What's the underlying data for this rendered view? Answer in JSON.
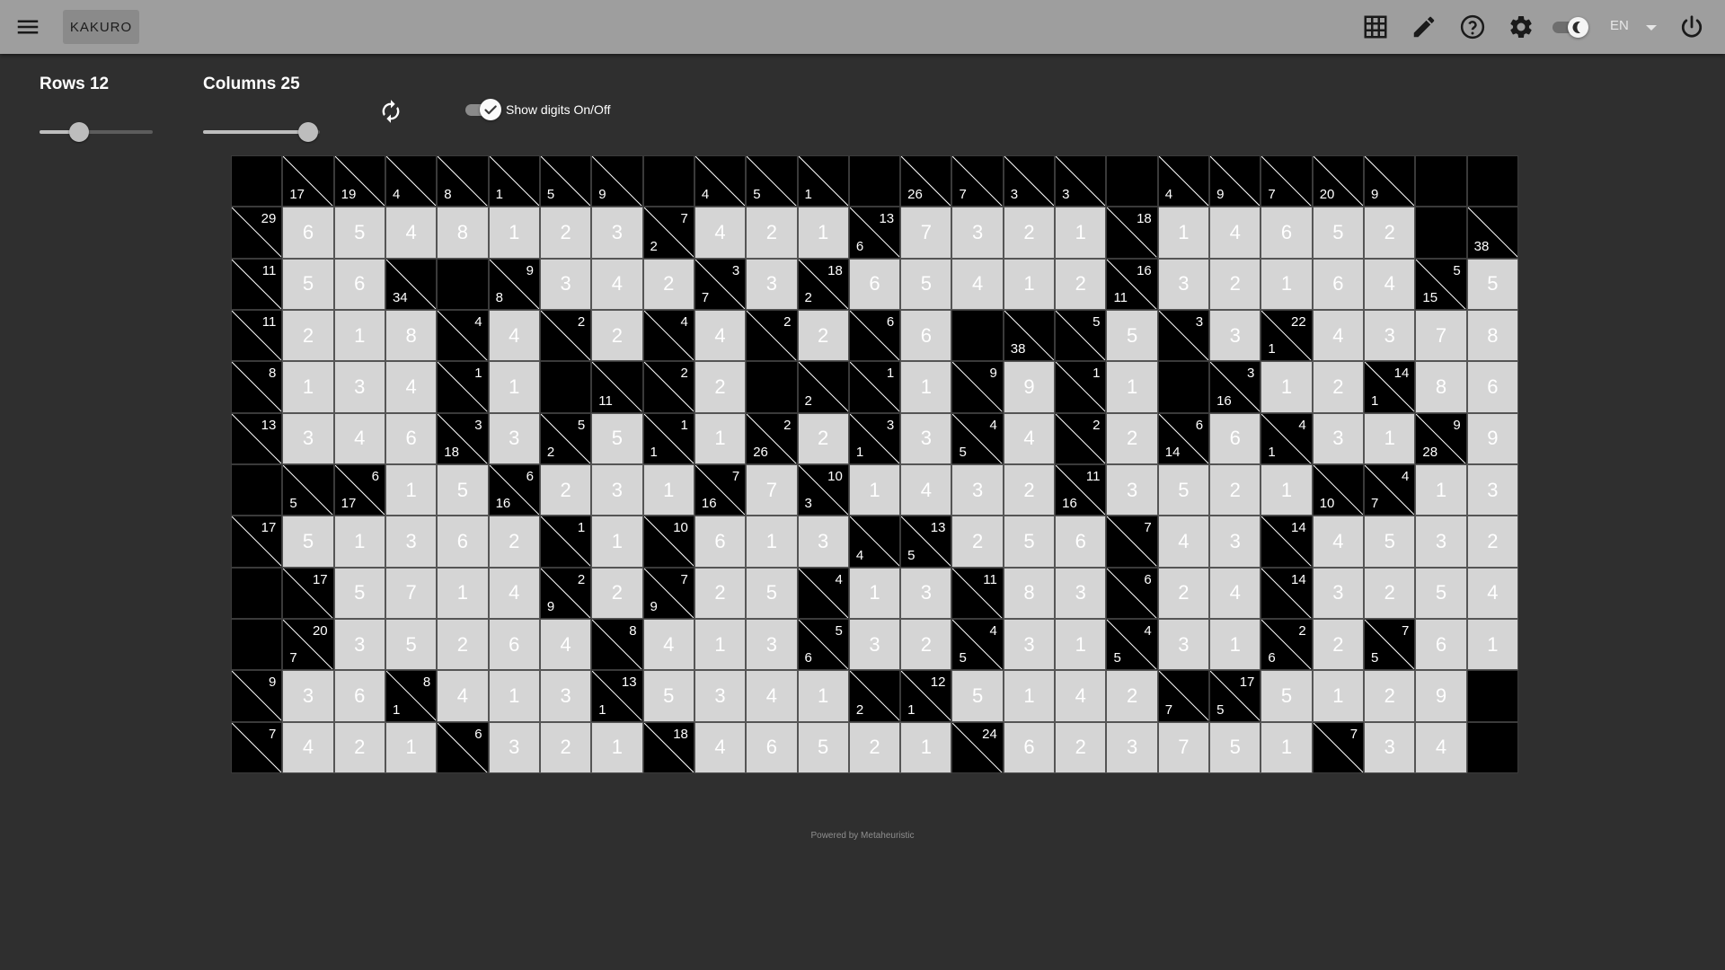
{
  "header": {
    "title": "KAKURO",
    "language": "EN",
    "icons": [
      "menu-icon",
      "grid-icon",
      "pencil-icon",
      "help-icon",
      "settings-icon",
      "dark-mode-icon",
      "power-icon"
    ]
  },
  "controls": {
    "rows_label": "Rows 12",
    "rows_value": 12,
    "rows_fraction": 0.35,
    "columns_label": "Columns 25",
    "columns_value": 25,
    "columns_fraction": 0.9,
    "show_digits_label": "Show digits On/Off",
    "show_digits_on": true,
    "dark_mode_on": true
  },
  "board": {
    "rows": 12,
    "columns": 25,
    "colors": {
      "black": "#000000",
      "white": "#d5d5d5",
      "digit": "#ffffff"
    },
    "cells": [
      [
        [
          "x"
        ],
        [
          "c",
          17
        ],
        [
          "c",
          19
        ],
        [
          "c",
          4
        ],
        [
          "c",
          8
        ],
        [
          "c",
          1
        ],
        [
          "c",
          5
        ],
        [
          "c",
          9
        ],
        [
          "x"
        ],
        [
          "c",
          4
        ],
        [
          "c",
          5
        ],
        [
          "c",
          1
        ],
        [
          "x"
        ],
        [
          "c",
          26
        ],
        [
          "c",
          7
        ],
        [
          "c",
          3
        ],
        [
          "c",
          3
        ],
        [
          "x"
        ],
        [
          "c",
          4
        ],
        [
          "c",
          9
        ],
        [
          "c",
          7
        ],
        [
          "c",
          20
        ],
        [
          "c",
          9
        ],
        [
          "x"
        ],
        [
          "x"
        ]
      ],
      [
        [
          "c",
          null,
          29
        ],
        6,
        5,
        4,
        8,
        1,
        2,
        3,
        [
          "c",
          2,
          7
        ],
        4,
        2,
        1,
        [
          "c",
          6,
          13
        ],
        7,
        3,
        2,
        1,
        [
          "c",
          null,
          18
        ],
        1,
        4,
        6,
        5,
        2,
        [
          "x"
        ],
        [
          "c",
          38
        ]
      ],
      [
        [
          "c",
          null,
          11
        ],
        5,
        6,
        [
          "c",
          34
        ],
        [
          "x"
        ],
        [
          "c",
          8,
          9
        ],
        3,
        4,
        2,
        [
          "c",
          7,
          3
        ],
        3,
        [
          "c",
          2,
          18
        ],
        6,
        5,
        4,
        1,
        2,
        [
          "c",
          11,
          16
        ],
        3,
        2,
        1,
        6,
        4,
        [
          "c",
          15,
          5
        ],
        5
      ],
      [
        [
          "c",
          null,
          11
        ],
        2,
        1,
        8,
        [
          "c",
          null,
          4
        ],
        4,
        [
          "c",
          null,
          2
        ],
        2,
        [
          "c",
          null,
          4
        ],
        4,
        [
          "c",
          null,
          2
        ],
        2,
        [
          "c",
          null,
          6
        ],
        6,
        [
          "x"
        ],
        [
          "c",
          38
        ],
        [
          "c",
          null,
          5
        ],
        5,
        [
          "c",
          null,
          3
        ],
        3,
        [
          "c",
          1,
          22
        ],
        4,
        3,
        7,
        8
      ],
      [
        [
          "c",
          null,
          8
        ],
        1,
        3,
        4,
        [
          "c",
          null,
          1
        ],
        1,
        [
          "x"
        ],
        [
          "c",
          11
        ],
        [
          "c",
          null,
          2
        ],
        2,
        [
          "x"
        ],
        [
          "c",
          2
        ],
        [
          "c",
          null,
          1
        ],
        1,
        [
          "c",
          null,
          9
        ],
        9,
        [
          "c",
          null,
          1
        ],
        1,
        [
          "x"
        ],
        [
          "c",
          16,
          3
        ],
        1,
        2,
        [
          "c",
          1,
          14
        ],
        8,
        6
      ],
      [
        [
          "c",
          null,
          13
        ],
        3,
        4,
        6,
        [
          "c",
          18,
          3
        ],
        3,
        [
          "c",
          2,
          5
        ],
        5,
        [
          "c",
          1,
          1
        ],
        1,
        [
          "c",
          26,
          2
        ],
        2,
        [
          "c",
          1,
          3
        ],
        3,
        [
          "c",
          5,
          4
        ],
        4,
        [
          "c",
          null,
          2
        ],
        2,
        [
          "c",
          14,
          6
        ],
        6,
        [
          "c",
          1,
          4
        ],
        3,
        1,
        [
          "c",
          28,
          9
        ],
        9
      ],
      [
        [
          "x"
        ],
        [
          "c",
          5
        ],
        [
          "c",
          17,
          6
        ],
        1,
        5,
        [
          "c",
          16,
          6
        ],
        2,
        3,
        1,
        [
          "c",
          16,
          7
        ],
        7,
        [
          "c",
          3,
          10
        ],
        1,
        4,
        3,
        2,
        [
          "c",
          16,
          11
        ],
        3,
        5,
        2,
        1,
        [
          "c",
          10
        ],
        [
          "c",
          7,
          4
        ],
        1,
        3
      ],
      [
        [
          "c",
          null,
          17
        ],
        5,
        1,
        3,
        6,
        2,
        [
          "c",
          null,
          1
        ],
        1,
        [
          "c",
          null,
          10
        ],
        6,
        1,
        3,
        [
          "c",
          4
        ],
        [
          "c",
          5,
          13
        ],
        2,
        5,
        6,
        [
          "c",
          null,
          7
        ],
        4,
        3,
        [
          "c",
          null,
          14
        ],
        4,
        5,
        3,
        2
      ],
      [
        [
          "x"
        ],
        [
          "c",
          null,
          17
        ],
        5,
        7,
        1,
        4,
        [
          "c",
          9,
          2
        ],
        2,
        [
          "c",
          9,
          7
        ],
        2,
        5,
        [
          "c",
          null,
          4
        ],
        1,
        3,
        [
          "c",
          null,
          11
        ],
        8,
        3,
        [
          "c",
          null,
          6
        ],
        2,
        4,
        [
          "c",
          null,
          14
        ],
        3,
        2,
        5,
        4
      ],
      [
        [
          "x"
        ],
        [
          "c",
          7,
          20
        ],
        3,
        5,
        2,
        6,
        4,
        [
          "c",
          null,
          8
        ],
        4,
        1,
        3,
        [
          "c",
          6,
          5
        ],
        3,
        2,
        [
          "c",
          5,
          4
        ],
        3,
        1,
        [
          "c",
          5,
          4
        ],
        3,
        1,
        [
          "c",
          6,
          2
        ],
        2,
        [
          "c",
          5,
          7
        ],
        6,
        1
      ],
      [
        [
          "c",
          null,
          9
        ],
        3,
        6,
        [
          "c",
          1,
          8
        ],
        4,
        1,
        3,
        [
          "c",
          1,
          13
        ],
        5,
        3,
        4,
        1,
        [
          "c",
          2
        ],
        [
          "c",
          1,
          12
        ],
        5,
        1,
        4,
        2,
        [
          "c",
          7
        ],
        [
          "c",
          5,
          17
        ],
        5,
        1,
        2,
        9,
        [
          "x"
        ]
      ],
      [
        [
          "c",
          null,
          7
        ],
        4,
        2,
        1,
        [
          "c",
          null,
          6
        ],
        3,
        2,
        1,
        [
          "c",
          null,
          18
        ],
        4,
        6,
        5,
        2,
        1,
        [
          "c",
          null,
          24
        ],
        6,
        2,
        3,
        7,
        5,
        1,
        [
          "c",
          null,
          7
        ],
        3,
        4,
        [
          "x"
        ]
      ]
    ]
  },
  "footer": {
    "text": "Powered by Metaheuristic"
  }
}
